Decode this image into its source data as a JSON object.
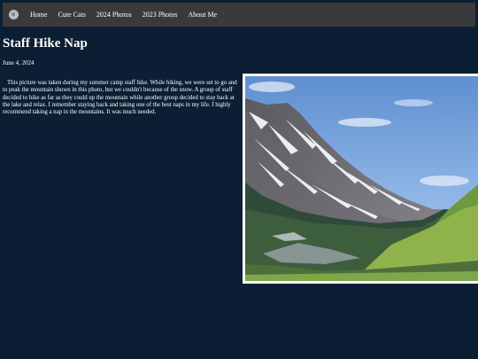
{
  "nav": {
    "logo_icon": "site-logo-icon",
    "items": [
      "Home",
      "Cute Cats",
      "2024 Photos",
      "2023 Photos",
      "About Me"
    ]
  },
  "post": {
    "title": "Staff Hike Nap",
    "date": "June 4, 2024",
    "body": "This picture was taken during my summer camp staff hike. While hiking, we were set to go and to peak the mountain shown in this photo, but we couldn't because of the snow. A group of staff decided to hike as far as they could up the mountain while another group decided to stay back at the lake and relax. I remember staying back and taking one of the best naps in my life. I highly recommend taking a nap in the mountains. It was much needed."
  },
  "colors": {
    "page_background": "#0b1e33",
    "navbar_background": "#3a3a3a",
    "text": "#ffffff"
  }
}
